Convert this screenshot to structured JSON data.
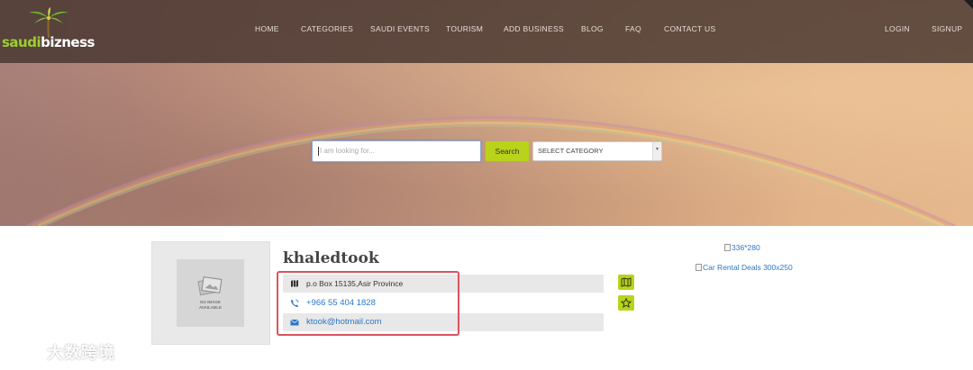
{
  "brand": {
    "logo_part1": "saudi",
    "logo_part2": "bizness",
    "accent_color": "#b9d31b"
  },
  "nav": {
    "items": [
      {
        "label": "HOME"
      },
      {
        "label": "CATEGORIES"
      },
      {
        "label": "SAUDI EVENTS"
      },
      {
        "label": "TOURISM"
      },
      {
        "label": "ADD BUSINESS"
      },
      {
        "label": "BLOG"
      },
      {
        "label": "FAQ"
      },
      {
        "label": "CONTACT US"
      }
    ],
    "login_label": "LOGIN",
    "signup_label": "SIGNUP"
  },
  "search": {
    "placeholder": "I am looking for...",
    "button_label": "Search",
    "category_selected": "SELECT CATEGORY"
  },
  "listing": {
    "name": "khaledtook",
    "image_placeholder_line1": "NO IMAGE",
    "image_placeholder_line2": "AVAILABLE",
    "address": "p.o Box 15135,Asir Province",
    "phone": "+966 55 404 1828",
    "email": "ktook@hotmail.com",
    "icons": {
      "address": "map-icon",
      "phone": "phone-icon",
      "email": "mail-icon",
      "map_button": "map-icon",
      "favorite_button": "star-icon"
    }
  },
  "ads": {
    "ad1_alt": "336*280",
    "ad2_alt": "Car Rental Deals 300x250"
  },
  "watermark": {
    "text": "大数跨境"
  }
}
